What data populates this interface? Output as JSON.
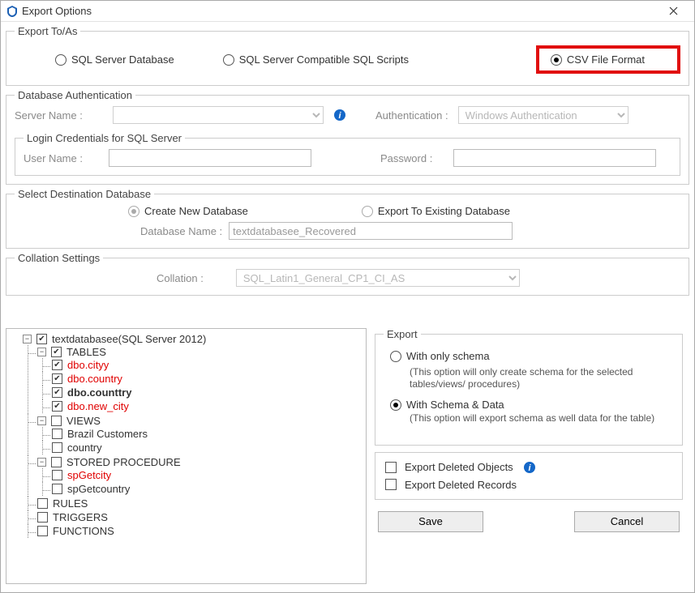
{
  "window": {
    "title": "Export Options"
  },
  "exportTo": {
    "legend": "Export To/As",
    "sql_db": "SQL Server Database",
    "sql_scripts": "SQL Server Compatible SQL Scripts",
    "csv": "CSV File Format"
  },
  "dbAuth": {
    "legend": "Database Authentication",
    "server_label": "Server Name :",
    "auth_label": "Authentication :",
    "auth_value": "Windows Authentication"
  },
  "login": {
    "legend": "Login Credentials for SQL Server",
    "user_label": "User Name :",
    "pass_label": "Password :"
  },
  "destDb": {
    "legend": "Select Destination Database",
    "create": "Create New Database",
    "existing": "Export To Existing Database",
    "dbname_label": "Database Name :",
    "dbname_value": "textdatabasee_Recovered"
  },
  "collation": {
    "legend": "Collation Settings",
    "label": "Collation :",
    "value": "SQL_Latin1_General_CP1_CI_AS"
  },
  "tree": {
    "root": "textdatabasee(SQL Server 2012)",
    "tables": "TABLES",
    "t1": "dbo.cityy",
    "t2": "dbo.country",
    "t3": "dbo.counttry",
    "t4": "dbo.new_city",
    "views": "VIEWS",
    "v1": "Brazil Customers",
    "v2": "country",
    "sp": "STORED PROCEDURE",
    "sp1": "spGetcity",
    "sp2": "spGetcountry",
    "rules": "RULES",
    "triggers": "TRIGGERS",
    "functions": "FUNCTIONS"
  },
  "export": {
    "legend": "Export",
    "schema_only": "With only schema",
    "schema_only_desc": "(This option will only create schema for the  selected tables/views/ procedures)",
    "schema_data": "With Schema & Data",
    "schema_data_desc": "(This option will export schema as well data for the table)",
    "deleted_objects": "Export Deleted Objects",
    "deleted_records": "Export Deleted Records"
  },
  "buttons": {
    "save": "Save",
    "cancel": "Cancel"
  }
}
